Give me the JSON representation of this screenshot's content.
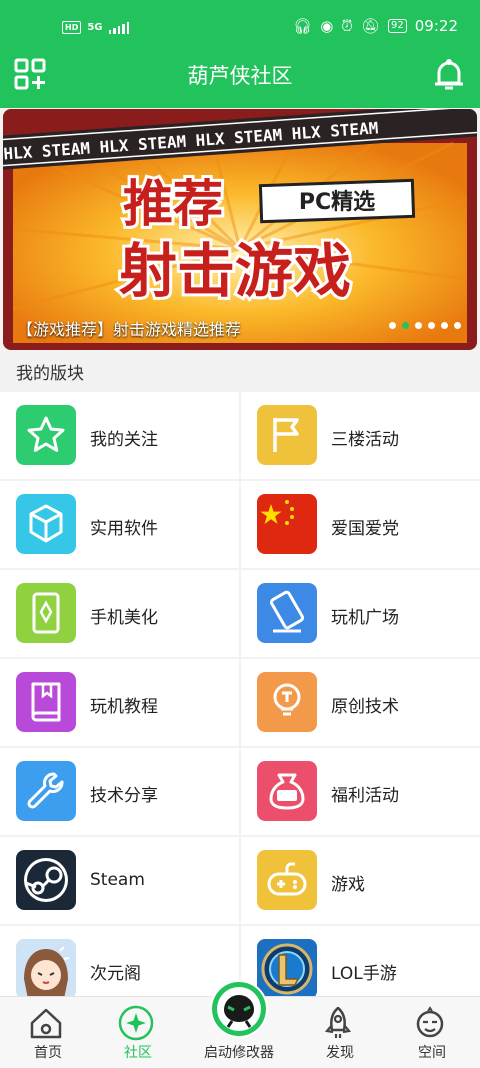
{
  "status_bar": {
    "left_badge": "HD",
    "network": "5G",
    "battery": "92",
    "time": "09:22"
  },
  "header": {
    "title": "葫芦侠社区"
  },
  "banner": {
    "strip_text": "HLX STEAM  HLX STEAM  HLX STEAM  HLX STEAM",
    "tag": "PC精选",
    "line1": "推荐",
    "line2": "射击游戏",
    "caption": "【游戏推荐】射击游戏精选推荐",
    "dots_total": 6,
    "dots_active": 2
  },
  "section": {
    "title": "我的版块"
  },
  "boards": [
    {
      "label": "我的关注",
      "icon": "star-icon",
      "color": "#2ecc71"
    },
    {
      "label": "三楼活动",
      "icon": "flag-icon",
      "color": "#f0c23b"
    },
    {
      "label": "实用软件",
      "icon": "cube-icon",
      "color": "#35c6e8"
    },
    {
      "label": "爱国爱党",
      "icon": "china-flag-icon",
      "color": "#de2910"
    },
    {
      "label": "手机美化",
      "icon": "phone-decor-icon",
      "color": "#8fd13f"
    },
    {
      "label": "玩机广场",
      "icon": "phone-tilt-icon",
      "color": "#3d8ae6"
    },
    {
      "label": "玩机教程",
      "icon": "book-icon",
      "color": "#b849d9"
    },
    {
      "label": "原创技术",
      "icon": "bulb-icon",
      "color": "#f2994a"
    },
    {
      "label": "技术分享",
      "icon": "wrench-icon",
      "color": "#3d9ef0"
    },
    {
      "label": "福利活动",
      "icon": "money-bag-icon",
      "color": "#ec4f6b"
    },
    {
      "label": "Steam",
      "icon": "steam-logo-icon",
      "color": "#1b2838"
    },
    {
      "label": "游戏",
      "icon": "gamepad-icon",
      "color": "#f0c23b"
    },
    {
      "label": "次元阁",
      "icon": "anime-avatar-icon",
      "color": "#cfe3f7"
    },
    {
      "label": "LOL手游",
      "icon": "lol-logo-icon",
      "color": "#1d6fbf"
    }
  ],
  "tabs": [
    {
      "label": "首页",
      "icon": "home-icon",
      "active": false
    },
    {
      "label": "社区",
      "icon": "community-icon",
      "active": true
    },
    {
      "label": "启动修改器",
      "icon": "launcher-icon",
      "active": false
    },
    {
      "label": "发现",
      "icon": "rocket-icon",
      "active": false
    },
    {
      "label": "空间",
      "icon": "profile-icon",
      "active": false
    }
  ],
  "colors": {
    "brand_green": "#22c35d",
    "banner_orange": "#f6a81d",
    "banner_red": "#d8312a"
  }
}
